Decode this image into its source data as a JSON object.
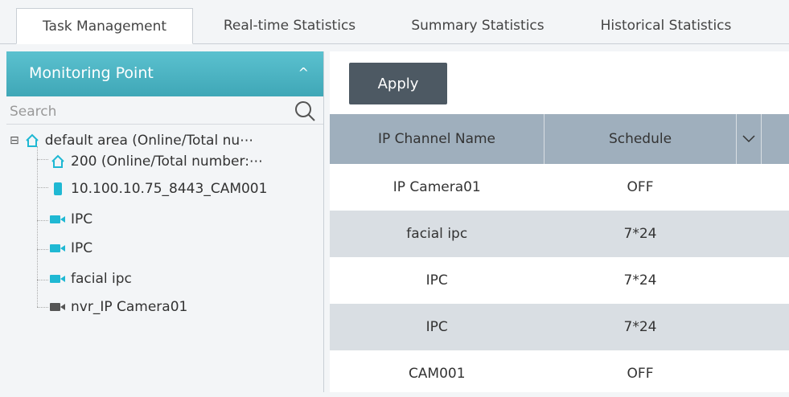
{
  "tabs": [
    {
      "label": "Task Management",
      "active": true
    },
    {
      "label": "Real-time Statistics"
    },
    {
      "label": "Summary Statistics"
    },
    {
      "label": "Historical Statistics"
    }
  ],
  "left_panel": {
    "title": "Monitoring Point",
    "search_placeholder": "Search",
    "tree": [
      {
        "label": "default area (Online/Total nu⋯",
        "icon": "home-icon"
      },
      {
        "label": "200 (Online/Total number:⋯",
        "icon": "home-icon"
      },
      {
        "label": "10.100.10.75_8443_CAM001",
        "icon": "device-icon"
      },
      {
        "label": "IPC",
        "icon": "camera-icon"
      },
      {
        "label": "IPC",
        "icon": "camera-icon"
      },
      {
        "label": "facial ipc",
        "icon": "camera-icon"
      },
      {
        "label": "nvr_IP Camera01",
        "icon": "camera-offline-icon"
      }
    ]
  },
  "toolbar": {
    "apply_label": "Apply"
  },
  "table": {
    "headers": [
      "IP Channel Name",
      "Schedule"
    ],
    "rows": [
      [
        "IP Camera01",
        "OFF"
      ],
      [
        "facial ipc",
        "7*24"
      ],
      [
        "IPC",
        "7*24"
      ],
      [
        "IPC",
        "7*24"
      ],
      [
        "CAM001",
        "OFF"
      ]
    ]
  },
  "colors": {
    "accent": "#4fb5c5",
    "camera_online": "#1fb8d3",
    "camera_offline": "#555555"
  }
}
